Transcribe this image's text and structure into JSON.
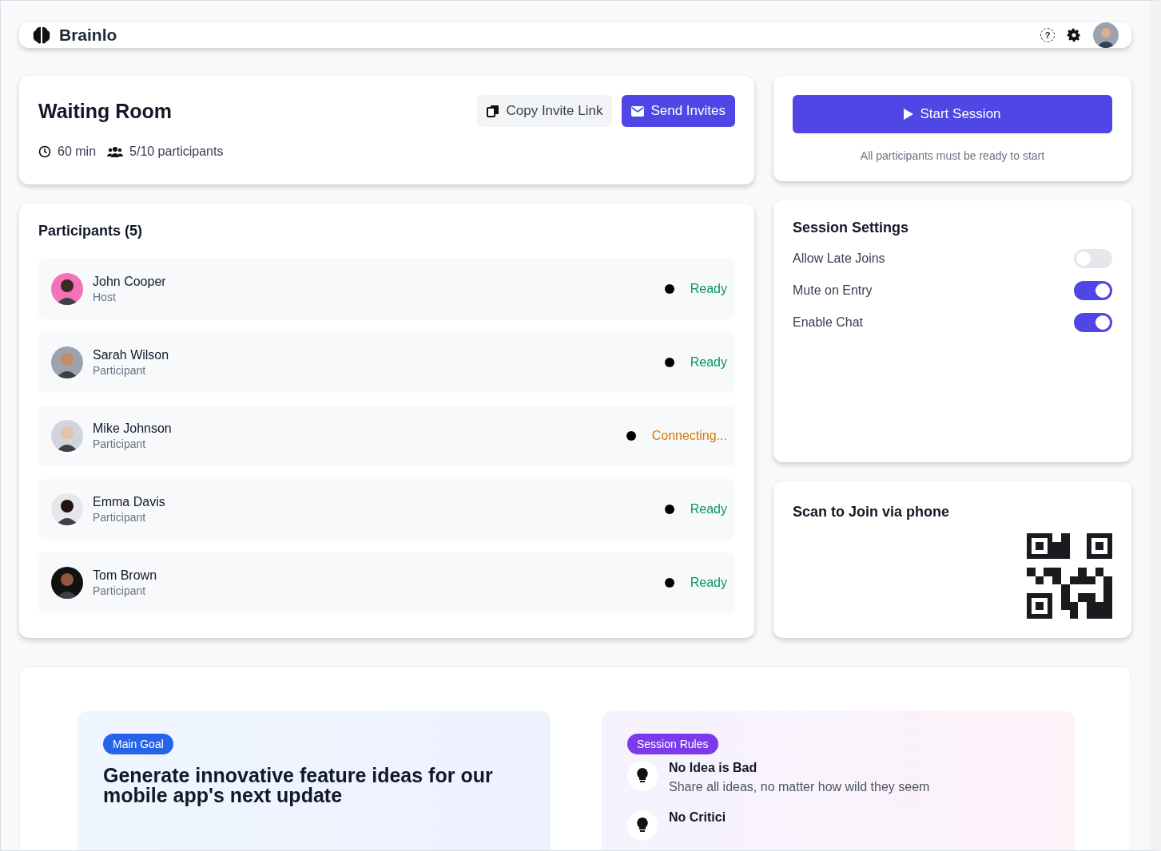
{
  "brand": {
    "name": "Brainlo"
  },
  "header": {
    "help": "?"
  },
  "waiting_room": {
    "title": "Waiting Room",
    "duration": "60 min",
    "participants": "5/10 participants",
    "buttons": [
      {
        "kind": "secondary",
        "label": "Copy Invite Link"
      },
      {
        "kind": "primary",
        "label": "Send Invites"
      }
    ]
  },
  "start": {
    "label": "Start Session",
    "note": "All participants must be ready to start"
  },
  "participants": {
    "title": "Participants (5)",
    "items": [
      {
        "name": "John Cooper",
        "role": "Host",
        "status": "Ready",
        "color": "#059669"
      },
      {
        "name": "Sarah Wilson",
        "role": "Participant",
        "status": "Ready",
        "color": "#059669"
      },
      {
        "name": "Mike Johnson",
        "role": "Participant",
        "status": "Connecting...",
        "color": "#d97706"
      },
      {
        "name": "Emma Davis",
        "role": "Participant",
        "status": "Ready",
        "color": "#059669"
      },
      {
        "name": "Tom Brown",
        "role": "Participant",
        "status": "Ready",
        "color": "#059669"
      }
    ]
  },
  "settings": {
    "title": "Session Settings",
    "items": [
      {
        "label": "Allow Late Joins",
        "on": false
      },
      {
        "label": "Mute on Entry",
        "on": true
      },
      {
        "label": "Enable Chat",
        "on": true
      }
    ]
  },
  "qr": {
    "title": "Scan to Join via phone"
  },
  "goal": {
    "badge": "Main Goal",
    "text": "Generate innovative feature ideas for our mobile app's next update"
  },
  "rules": {
    "badge": "Session Rules",
    "items": [
      {
        "title": "No Idea is Bad",
        "text": "Share all ideas, no matter how wild they seem"
      },
      {
        "title": "No Critici"
      }
    ]
  }
}
